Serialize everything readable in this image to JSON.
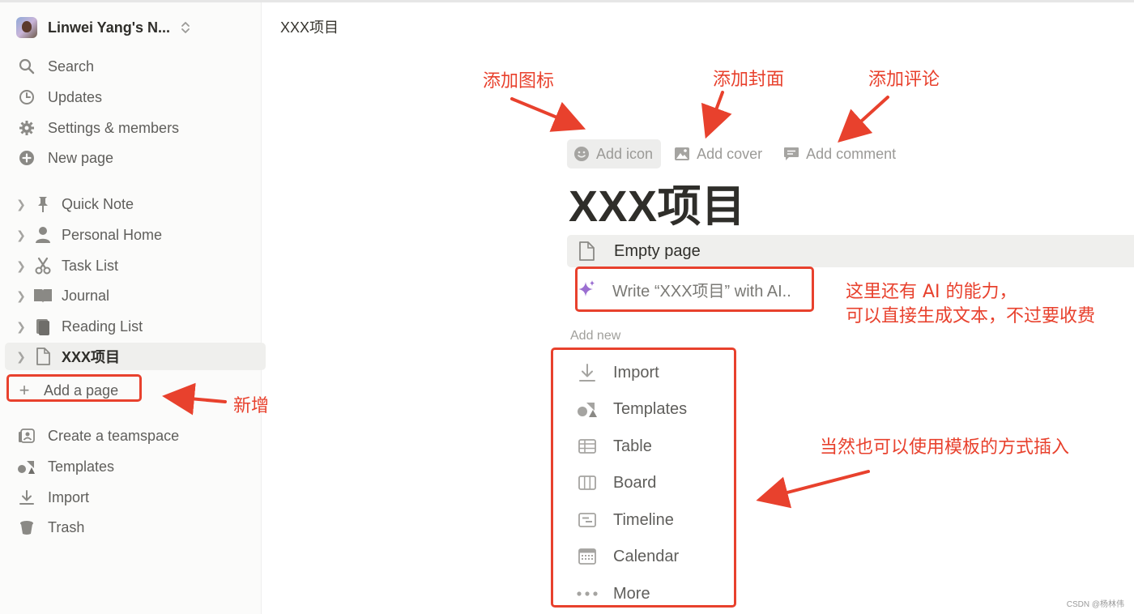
{
  "sidebar": {
    "workspace": {
      "name": "Linwei Yang's N..."
    },
    "nav": [
      {
        "label": "Search",
        "icon": "search-icon"
      },
      {
        "label": "Updates",
        "icon": "clock-icon"
      },
      {
        "label": "Settings & members",
        "icon": "gear-icon"
      },
      {
        "label": "New page",
        "icon": "plus-circle-icon"
      }
    ],
    "pages": [
      {
        "label": "Quick Note",
        "icon": "pin-icon"
      },
      {
        "label": "Personal Home",
        "icon": "person-icon"
      },
      {
        "label": "Task List",
        "icon": "scissors-icon"
      },
      {
        "label": "Journal",
        "icon": "book-icon"
      },
      {
        "label": "Reading List",
        "icon": "books-icon"
      },
      {
        "label": "XXX项目",
        "icon": "page-icon",
        "active": true
      }
    ],
    "add_page": "Add a page",
    "bottom": [
      {
        "label": "Create a teamspace",
        "icon": "teamspace-icon"
      },
      {
        "label": "Templates",
        "icon": "shapes-icon"
      },
      {
        "label": "Import",
        "icon": "download-icon"
      },
      {
        "label": "Trash",
        "icon": "trash-icon"
      }
    ]
  },
  "main": {
    "breadcrumb": "XXX项目",
    "meta": {
      "add_icon": "Add icon",
      "add_cover": "Add cover",
      "add_comment": "Add comment"
    },
    "title": "XXX项目",
    "empty_page": "Empty page",
    "ai_write": "Write “XXX项目” with AI..",
    "add_new_label": "Add new",
    "add_new": [
      {
        "label": "Import",
        "icon": "download-icon"
      },
      {
        "label": "Templates",
        "icon": "shapes-icon"
      },
      {
        "label": "Table",
        "icon": "table-icon"
      },
      {
        "label": "Board",
        "icon": "board-icon"
      },
      {
        "label": "Timeline",
        "icon": "timeline-icon"
      },
      {
        "label": "Calendar",
        "icon": "calendar-icon"
      },
      {
        "label": "More",
        "icon": "more-icon"
      }
    ]
  },
  "annotations": {
    "add_icon": "添加图标",
    "add_cover": "添加封面",
    "add_comment": "添加评论",
    "new": "新增",
    "ai_line1": "这里还有 AI 的能力，",
    "ai_line2": "可以直接生成文本，不过要收费",
    "templates": "当然也可以使用模板的方式插入",
    "color": "#e8412d"
  },
  "watermark": "CSDN @杨林伟"
}
